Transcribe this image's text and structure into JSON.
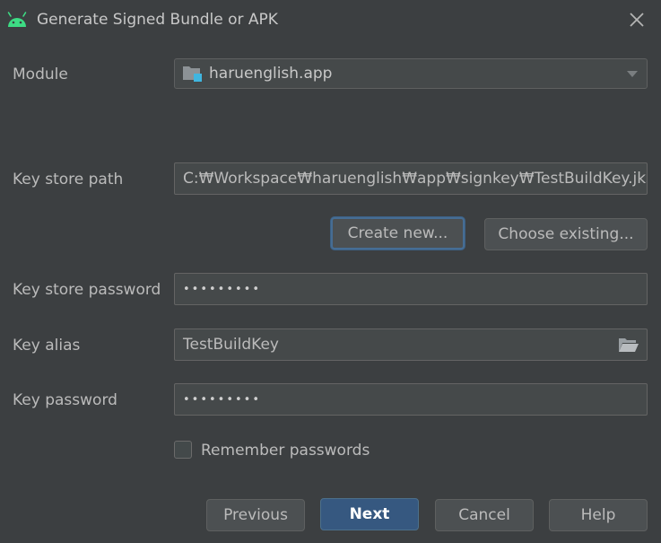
{
  "window": {
    "title": "Generate Signed Bundle or APK",
    "icon": "android-icon",
    "accent": "#3ddc84"
  },
  "form": {
    "module_label": "Module",
    "module_value": "haruenglish.app",
    "keystore_path_label": "Key store path",
    "keystore_path_value": "C:₩Workspace₩haruenglish₩app₩signkey₩TestBuildKey.jks",
    "create_new_label": "Create new...",
    "choose_existing_label": "Choose existing...",
    "keystore_password_label": "Key store password",
    "keystore_password_mask": "•••••••••",
    "key_alias_label": "Key alias",
    "key_alias_value": "TestBuildKey",
    "key_password_label": "Key password",
    "key_password_mask": "•••••••••",
    "remember_label": "Remember passwords",
    "remember_checked": false
  },
  "footer": {
    "previous_label": "Previous",
    "next_label": "Next",
    "cancel_label": "Cancel",
    "help_label": "Help"
  },
  "colors": {
    "background": "#3c3f41",
    "field": "#45494a",
    "primary_button": "#365880",
    "focus_border": "#466d94"
  }
}
